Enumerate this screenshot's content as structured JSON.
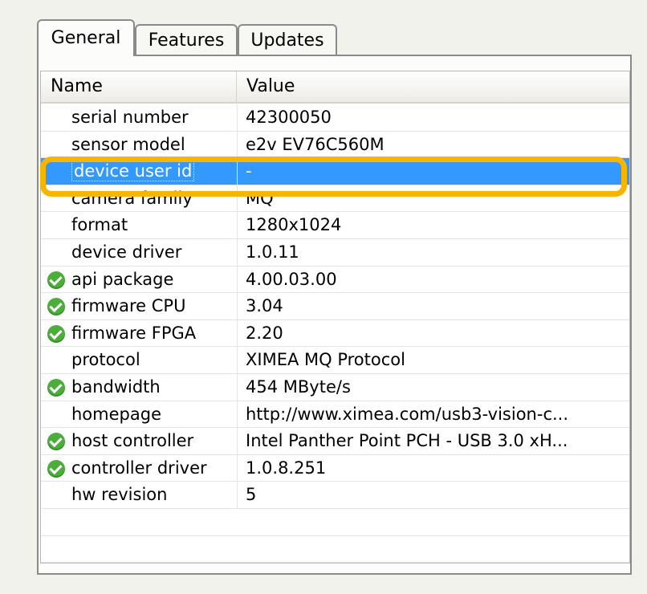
{
  "tabs": [
    {
      "label": "General",
      "active": true
    },
    {
      "label": "Features",
      "active": false
    },
    {
      "label": "Updates",
      "active": false
    }
  ],
  "columns": {
    "name": "Name",
    "value": "Value"
  },
  "rows": [
    {
      "name": "serial number",
      "value": "42300050",
      "icon": ""
    },
    {
      "name": "sensor model",
      "value": "e2v EV76C560M",
      "icon": ""
    },
    {
      "name": "device user id",
      "value": "-",
      "icon": "",
      "selected": true
    },
    {
      "name": "camera family",
      "value": "MQ",
      "icon": ""
    },
    {
      "name": "format",
      "value": "1280x1024",
      "icon": ""
    },
    {
      "name": "device driver",
      "value": "1.0.11",
      "icon": ""
    },
    {
      "name": "api package",
      "value": "4.00.03.00",
      "icon": "check-icon"
    },
    {
      "name": "firmware CPU",
      "value": "3.04",
      "icon": "check-icon"
    },
    {
      "name": "firmware FPGA",
      "value": "2.20",
      "icon": "check-icon"
    },
    {
      "name": "protocol",
      "value": "XIMEA MQ Protocol",
      "icon": ""
    },
    {
      "name": "bandwidth",
      "value": "454 MByte/s",
      "icon": "check-icon"
    },
    {
      "name": "homepage",
      "value": "http://www.ximea.com/usb3-vision-c...",
      "icon": ""
    },
    {
      "name": "host controller",
      "value": "Intel Panther Point PCH - USB 3.0 xH...",
      "icon": "check-icon"
    },
    {
      "name": "controller driver",
      "value": "1.0.8.251",
      "icon": "check-icon"
    },
    {
      "name": "hw revision",
      "value": "5",
      "icon": ""
    },
    {
      "name": "",
      "value": "",
      "icon": ""
    },
    {
      "name": "",
      "value": "",
      "icon": ""
    },
    {
      "name": "",
      "value": "",
      "icon": ""
    }
  ],
  "colors": {
    "selection": "#3399ff",
    "highlight_ring": "#f7b500",
    "check": "#4cae3a"
  }
}
